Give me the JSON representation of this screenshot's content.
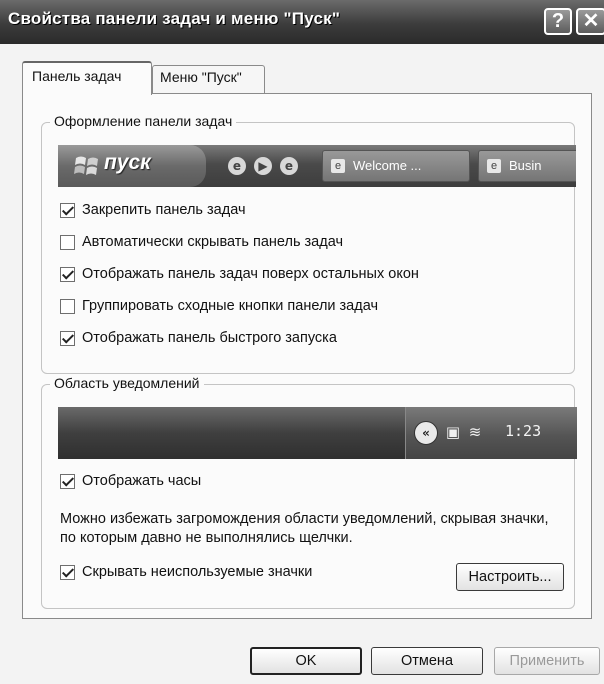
{
  "window": {
    "title": "Свойства панели задач и меню \"Пуск\"",
    "help_glyph": "?",
    "close_glyph": "✕"
  },
  "tabs": [
    {
      "label": "Панель задач",
      "active": true
    },
    {
      "label": "Меню \"Пуск\"",
      "active": false
    }
  ],
  "taskbar_group": {
    "legend": "Оформление панели задач",
    "preview": {
      "start_label": "пуск",
      "task_buttons": [
        "Welcome ...",
        "Busin"
      ]
    },
    "options": [
      {
        "label": "Закрепить панель задач",
        "checked": true
      },
      {
        "label": "Автоматически скрывать панель задач",
        "checked": false
      },
      {
        "label": "Отображать панель задач поверх остальных окон",
        "checked": true
      },
      {
        "label": "Группировать сходные кнопки панели задач",
        "checked": false
      },
      {
        "label": "Отображать панель быстрого запуска",
        "checked": true
      }
    ]
  },
  "notify_group": {
    "legend": "Область уведомлений",
    "preview": {
      "chevron": "«",
      "clock": "1:23"
    },
    "show_clock": {
      "label": "Отображать часы",
      "checked": true
    },
    "description": "Можно избежать загромождения области уведомлений, скрывая значки, по которым давно не выполнялись щелчки.",
    "hide_icons": {
      "label": "Скрывать неиспользуемые значки",
      "checked": true
    },
    "customize_label": "Настроить..."
  },
  "footer": {
    "ok_label": "OK",
    "cancel_label": "Отмена",
    "apply_label": "Применить"
  }
}
